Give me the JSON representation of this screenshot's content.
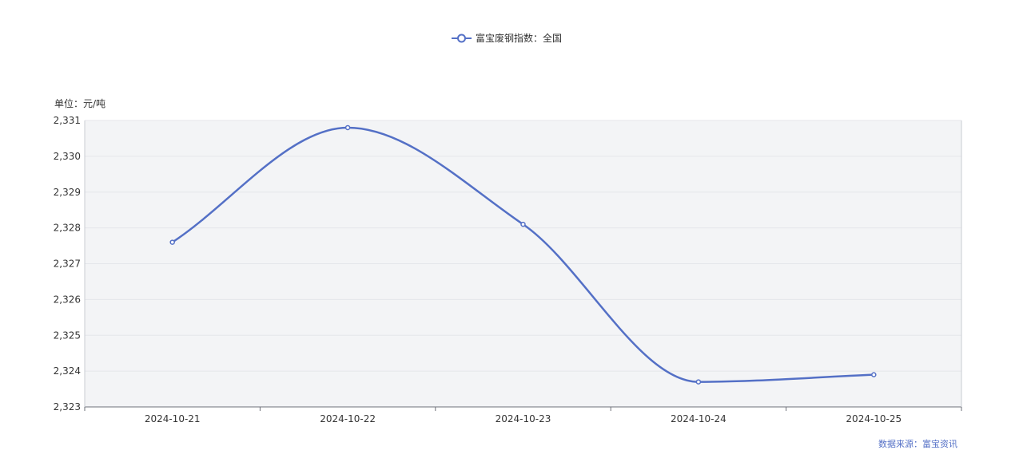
{
  "chart_data": {
    "type": "line",
    "smooth": true,
    "x": [
      "2024-10-21",
      "2024-10-22",
      "2024-10-23",
      "2024-10-24",
      "2024-10-25"
    ],
    "series": [
      {
        "name": "富宝废钢指数：全国",
        "values": [
          2327.6,
          2330.8,
          2328.1,
          2323.7,
          2323.9
        ],
        "color": "#5470c6"
      }
    ],
    "ylabel": "单位：元/吨",
    "ylim": [
      2323,
      2331
    ],
    "yticks": [
      "2,323",
      "2,324",
      "2,325",
      "2,326",
      "2,327",
      "2,328",
      "2,329",
      "2,330",
      "2,331"
    ],
    "grid": true,
    "legend": "top-center",
    "plot_background": "#f3f4f6",
    "source": "数据来源：富宝资讯",
    "source_color": "#5470c6"
  }
}
